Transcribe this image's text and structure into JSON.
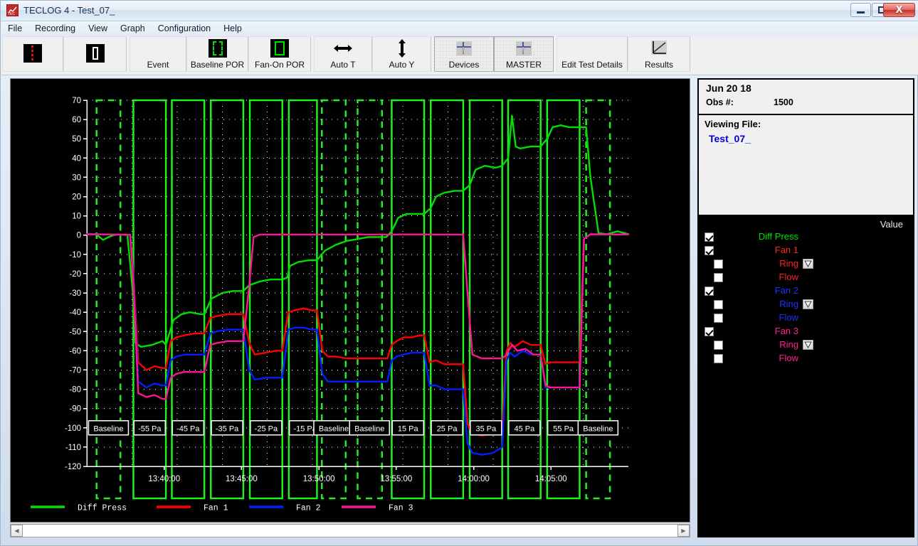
{
  "window": {
    "title": "TECLOG 4 - Test_07_",
    "app_icon": "chart-icon",
    "minimize_label": "Minimize",
    "maximize_label": "Maximize",
    "close_label": "X"
  },
  "menu": {
    "items": [
      "File",
      "Recording",
      "View",
      "Graph",
      "Configuration",
      "Help"
    ]
  },
  "toolbar": {
    "buttons": [
      {
        "label": "",
        "icon": "red-dashed-line-icon",
        "pressed": false
      },
      {
        "label": "",
        "icon": "white-bar-icon",
        "pressed": false
      },
      {
        "label": "Event",
        "icon": "",
        "pressed": false
      },
      {
        "label": "Baseline POR",
        "icon": "green-dashed-box-icon",
        "pressed": false
      },
      {
        "label": "Fan-On POR",
        "icon": "green-solid-box-icon",
        "pressed": false
      },
      {
        "label": "Auto T",
        "icon": "horizontal-arrows-icon",
        "pressed": false
      },
      {
        "label": "Auto Y",
        "icon": "vertical-arrows-icon",
        "pressed": false
      },
      {
        "label": "Devices",
        "icon": "gauge-icon",
        "pressed": true
      },
      {
        "label": "MASTER",
        "icon": "gauge-icon",
        "pressed": true
      },
      {
        "label": "Edit Test Details",
        "icon": "",
        "pressed": false
      },
      {
        "label": "Results",
        "icon": "trend-icon",
        "pressed": false
      }
    ]
  },
  "info": {
    "date": "Jun 20 18",
    "obs_label": "Obs #:",
    "obs_value": "1500",
    "viewing_file_label": "Viewing File:",
    "file_name": "Test_07_",
    "file_name_color": "#0000d0"
  },
  "channels": {
    "value_header": "Value",
    "rows": [
      {
        "label": "Diff Press",
        "color": "#00e000",
        "checked": true,
        "indent": 0,
        "dropdown": false
      },
      {
        "label": "Fan 1",
        "color": "#ff2020",
        "checked": true,
        "indent": 0,
        "dropdown": false
      },
      {
        "label": "Ring",
        "color": "#ff2020",
        "checked": false,
        "indent": 1,
        "dropdown": true
      },
      {
        "label": "Flow",
        "color": "#ff2020",
        "checked": false,
        "indent": 1,
        "dropdown": false
      },
      {
        "label": "Fan 2",
        "color": "#2030ff",
        "checked": true,
        "indent": 0,
        "dropdown": false
      },
      {
        "label": "Ring",
        "color": "#2030ff",
        "checked": false,
        "indent": 1,
        "dropdown": true
      },
      {
        "label": "Flow",
        "color": "#2030ff",
        "checked": false,
        "indent": 1,
        "dropdown": false
      },
      {
        "label": "Fan 3",
        "color": "#ff2090",
        "checked": true,
        "indent": 0,
        "dropdown": false
      },
      {
        "label": "Ring",
        "color": "#ff2090",
        "checked": false,
        "indent": 1,
        "dropdown": true
      },
      {
        "label": "Flow",
        "color": "#ff2090",
        "checked": false,
        "indent": 1,
        "dropdown": false
      }
    ]
  },
  "scrollbar": {
    "left_arrow": "◀",
    "right_arrow": "▶"
  },
  "chart_data": {
    "type": "line",
    "title": "",
    "xlabel": "",
    "ylabel": "",
    "background": "#000000",
    "grid": true,
    "grid_color": "#ffffff",
    "axis_color": "#ffffff",
    "ylim": [
      -120,
      70
    ],
    "ytick_step": 10,
    "yticks": [
      70,
      60,
      50,
      40,
      30,
      20,
      10,
      0,
      -10,
      -20,
      -30,
      -40,
      -50,
      -60,
      -70,
      -80,
      -90,
      -100,
      -110,
      -120
    ],
    "xlim": [
      "13:37:40",
      "14:06:40"
    ],
    "xticks": [
      "13:40:00",
      "13:45:00",
      "13:50:00",
      "13:55:00",
      "14:00:00",
      "14:05:00"
    ],
    "legend_position": "bottom",
    "legend": [
      {
        "name": "Diff Press",
        "color": "#00e000"
      },
      {
        "name": "Fan 1",
        "color": "#ff0000"
      },
      {
        "name": "Fan 2",
        "color": "#0020ff"
      },
      {
        "name": "Fan 3",
        "color": "#ff1493"
      }
    ],
    "step_labels": [
      {
        "text": "Baseline",
        "x_frac": 0.04
      },
      {
        "text": "-55 Pa",
        "x_frac": 0.116
      },
      {
        "text": "-45 Pa",
        "x_frac": 0.187
      },
      {
        "text": "-35 Pa",
        "x_frac": 0.259
      },
      {
        "text": "-25 Pa",
        "x_frac": 0.331
      },
      {
        "text": "-15 Pa",
        "x_frac": 0.403
      },
      {
        "text": "Baseline",
        "x_frac": 0.456
      },
      {
        "text": "Baseline",
        "x_frac": 0.522
      },
      {
        "text": "15 Pa",
        "x_frac": 0.593
      },
      {
        "text": "25 Pa",
        "x_frac": 0.665
      },
      {
        "text": "35 Pa",
        "x_frac": 0.737
      },
      {
        "text": "45 Pa",
        "x_frac": 0.808
      },
      {
        "text": "55 Pa",
        "x_frac": 0.88
      },
      {
        "text": "Baseline",
        "x_frac": 0.944
      }
    ],
    "event_bands_solid": [
      [
        0.086,
        0.146
      ],
      [
        0.157,
        0.217
      ],
      [
        0.229,
        0.289
      ],
      [
        0.301,
        0.361
      ],
      [
        0.373,
        0.425
      ],
      [
        0.563,
        0.623
      ],
      [
        0.635,
        0.695
      ],
      [
        0.707,
        0.767
      ],
      [
        0.778,
        0.838
      ],
      [
        0.85,
        0.91
      ]
    ],
    "event_bands_dashed": [
      [
        0.018,
        0.062
      ],
      [
        0.434,
        0.478
      ],
      [
        0.5,
        0.545
      ],
      [
        0.922,
        0.966
      ]
    ],
    "series": [
      {
        "name": "Diff Press",
        "color": "#00e000",
        "x": [
          0.0,
          0.018,
          0.03,
          0.04,
          0.052,
          0.062,
          0.075,
          0.085,
          0.09,
          0.1,
          0.12,
          0.14,
          0.146,
          0.16,
          0.175,
          0.19,
          0.21,
          0.217,
          0.23,
          0.25,
          0.27,
          0.289,
          0.3,
          0.32,
          0.34,
          0.361,
          0.37,
          0.375,
          0.39,
          0.41,
          0.425,
          0.44,
          0.46,
          0.48,
          0.5,
          0.52,
          0.54,
          0.553,
          0.563,
          0.575,
          0.59,
          0.61,
          0.623,
          0.635,
          0.645,
          0.66,
          0.68,
          0.695,
          0.707,
          0.718,
          0.735,
          0.755,
          0.767,
          0.778,
          0.785,
          0.792,
          0.8,
          0.82,
          0.838,
          0.85,
          0.86,
          0.875,
          0.89,
          0.91,
          0.922,
          0.93,
          0.945,
          0.96,
          0.98,
          1.0
        ],
        "y": [
          0.5,
          0.3,
          -2.5,
          -1.0,
          0.2,
          0.3,
          0.0,
          -30,
          -56,
          -58,
          -57,
          -55,
          -57,
          -44,
          -41,
          -40,
          -41,
          -41,
          -33,
          -30,
          -29,
          -29,
          -26,
          -24,
          -23,
          -23,
          -22,
          -16,
          -14,
          -13,
          -13,
          -8,
          -5,
          -3,
          -2,
          -1,
          -1,
          -1,
          2,
          9,
          11,
          11,
          11,
          14,
          20,
          22,
          23,
          23,
          26,
          34,
          36,
          35,
          36,
          40,
          62,
          46,
          45,
          46,
          46,
          50,
          56,
          57,
          56,
          56,
          56,
          30,
          1,
          0.5,
          2,
          0.5
        ]
      },
      {
        "name": "Fan 1",
        "color": "#ff0000",
        "x": [
          0.0,
          0.03,
          0.06,
          0.08,
          0.086,
          0.095,
          0.11,
          0.125,
          0.14,
          0.146,
          0.155,
          0.165,
          0.18,
          0.2,
          0.217,
          0.228,
          0.24,
          0.26,
          0.28,
          0.289,
          0.3,
          0.31,
          0.33,
          0.35,
          0.361,
          0.372,
          0.385,
          0.4,
          0.415,
          0.425,
          0.435,
          0.445,
          0.46,
          0.48,
          0.5,
          0.52,
          0.545,
          0.555,
          0.563,
          0.572,
          0.585,
          0.6,
          0.615,
          0.623,
          0.633,
          0.645,
          0.66,
          0.68,
          0.695,
          0.703,
          0.712,
          0.73,
          0.75,
          0.767,
          0.775,
          0.782,
          0.79,
          0.805,
          0.82,
          0.838,
          0.847,
          0.855,
          0.87,
          0.89,
          0.91,
          0.918,
          0.93,
          0.95,
          0.975,
          1.0
        ],
        "y": [
          0.5,
          0.4,
          0.3,
          0.2,
          -20,
          -66,
          -70,
          -68,
          -69,
          -69,
          -55,
          -53,
          -52,
          -51,
          -51,
          -43,
          -42,
          -41,
          -41,
          -41,
          -56,
          -62,
          -61,
          -60,
          -60,
          -40,
          -39,
          -38,
          -39,
          -39,
          -60,
          -63,
          -63,
          -64,
          -64,
          -64,
          -64,
          -64,
          -57,
          -55,
          -53,
          -53,
          -52,
          -52,
          -66,
          -65,
          -67,
          -67,
          -67,
          -98,
          -103,
          -104,
          -103,
          -100,
          -60,
          -56,
          -58,
          -55,
          -57,
          -57,
          -67,
          -66,
          -66,
          -66,
          -66,
          -2,
          0.5,
          0.4,
          0.4,
          0.4
        ]
      },
      {
        "name": "Fan 2",
        "color": "#0020ff",
        "x": [
          0.0,
          0.03,
          0.06,
          0.08,
          0.086,
          0.095,
          0.11,
          0.125,
          0.14,
          0.146,
          0.155,
          0.165,
          0.18,
          0.2,
          0.217,
          0.228,
          0.24,
          0.26,
          0.28,
          0.289,
          0.3,
          0.31,
          0.33,
          0.35,
          0.361,
          0.372,
          0.385,
          0.4,
          0.415,
          0.425,
          0.435,
          0.445,
          0.46,
          0.48,
          0.5,
          0.52,
          0.545,
          0.555,
          0.563,
          0.572,
          0.585,
          0.6,
          0.615,
          0.623,
          0.633,
          0.645,
          0.66,
          0.68,
          0.695,
          0.703,
          0.712,
          0.73,
          0.75,
          0.767,
          0.775,
          0.782,
          0.79,
          0.805,
          0.82,
          0.838,
          0.847,
          0.855,
          0.87,
          0.89,
          0.91,
          0.918,
          0.93,
          0.95,
          0.975,
          1.0
        ],
        "y": [
          0.5,
          0.4,
          0.3,
          0.2,
          -22,
          -76,
          -79,
          -77,
          -78,
          -78,
          -65,
          -63,
          -62,
          -62,
          -62,
          -51,
          -50,
          -49,
          -49,
          -49,
          -70,
          -75,
          -74,
          -74,
          -74,
          -49,
          -48,
          -48,
          -49,
          -49,
          -72,
          -76,
          -76,
          -76,
          -76,
          -76,
          -76,
          -76,
          -65,
          -63,
          -62,
          -61,
          -61,
          -61,
          -78,
          -78,
          -80,
          -80,
          -80,
          -108,
          -113,
          -114,
          -113,
          -110,
          -65,
          -61,
          -63,
          -60,
          -62,
          -62,
          -79,
          -79,
          -79,
          -79,
          -79,
          -2,
          0.5,
          0.4,
          0.4,
          0.4
        ]
      },
      {
        "name": "Fan 3",
        "color": "#ff1493",
        "x": [
          0.0,
          0.03,
          0.06,
          0.08,
          0.086,
          0.095,
          0.11,
          0.125,
          0.14,
          0.146,
          0.155,
          0.165,
          0.18,
          0.2,
          0.217,
          0.228,
          0.24,
          0.26,
          0.28,
          0.289,
          0.3,
          0.308,
          0.32,
          0.34,
          0.361,
          0.372,
          0.385,
          0.4,
          0.415,
          0.425,
          0.44,
          0.46,
          0.48,
          0.5,
          0.52,
          0.545,
          0.563,
          0.58,
          0.6,
          0.623,
          0.645,
          0.66,
          0.68,
          0.695,
          0.703,
          0.712,
          0.73,
          0.75,
          0.767,
          0.775,
          0.785,
          0.795,
          0.81,
          0.825,
          0.838,
          0.847,
          0.855,
          0.87,
          0.89,
          0.91,
          0.918,
          0.93,
          0.95,
          0.975,
          1.0
        ],
        "y": [
          0.5,
          0.4,
          0.3,
          0.2,
          -25,
          -82,
          -84,
          -83,
          -85,
          -85,
          -74,
          -72,
          -71,
          -71,
          -71,
          -57,
          -56,
          -55,
          -55,
          -55,
          -26,
          -1,
          0.3,
          0.3,
          0.3,
          0.3,
          0.3,
          0.3,
          0.3,
          0.3,
          0.3,
          0.3,
          0.3,
          0.4,
          0.3,
          0.3,
          0.3,
          0.4,
          0.4,
          0.4,
          0.3,
          0.3,
          0.3,
          0.3,
          -30,
          -62,
          -64,
          -64,
          -64,
          -62,
          -57,
          -60,
          -59,
          -62,
          -62,
          -78,
          -79,
          -79,
          -79,
          -79,
          -2,
          0.5,
          0.4,
          0.4,
          0.4
        ]
      }
    ]
  }
}
